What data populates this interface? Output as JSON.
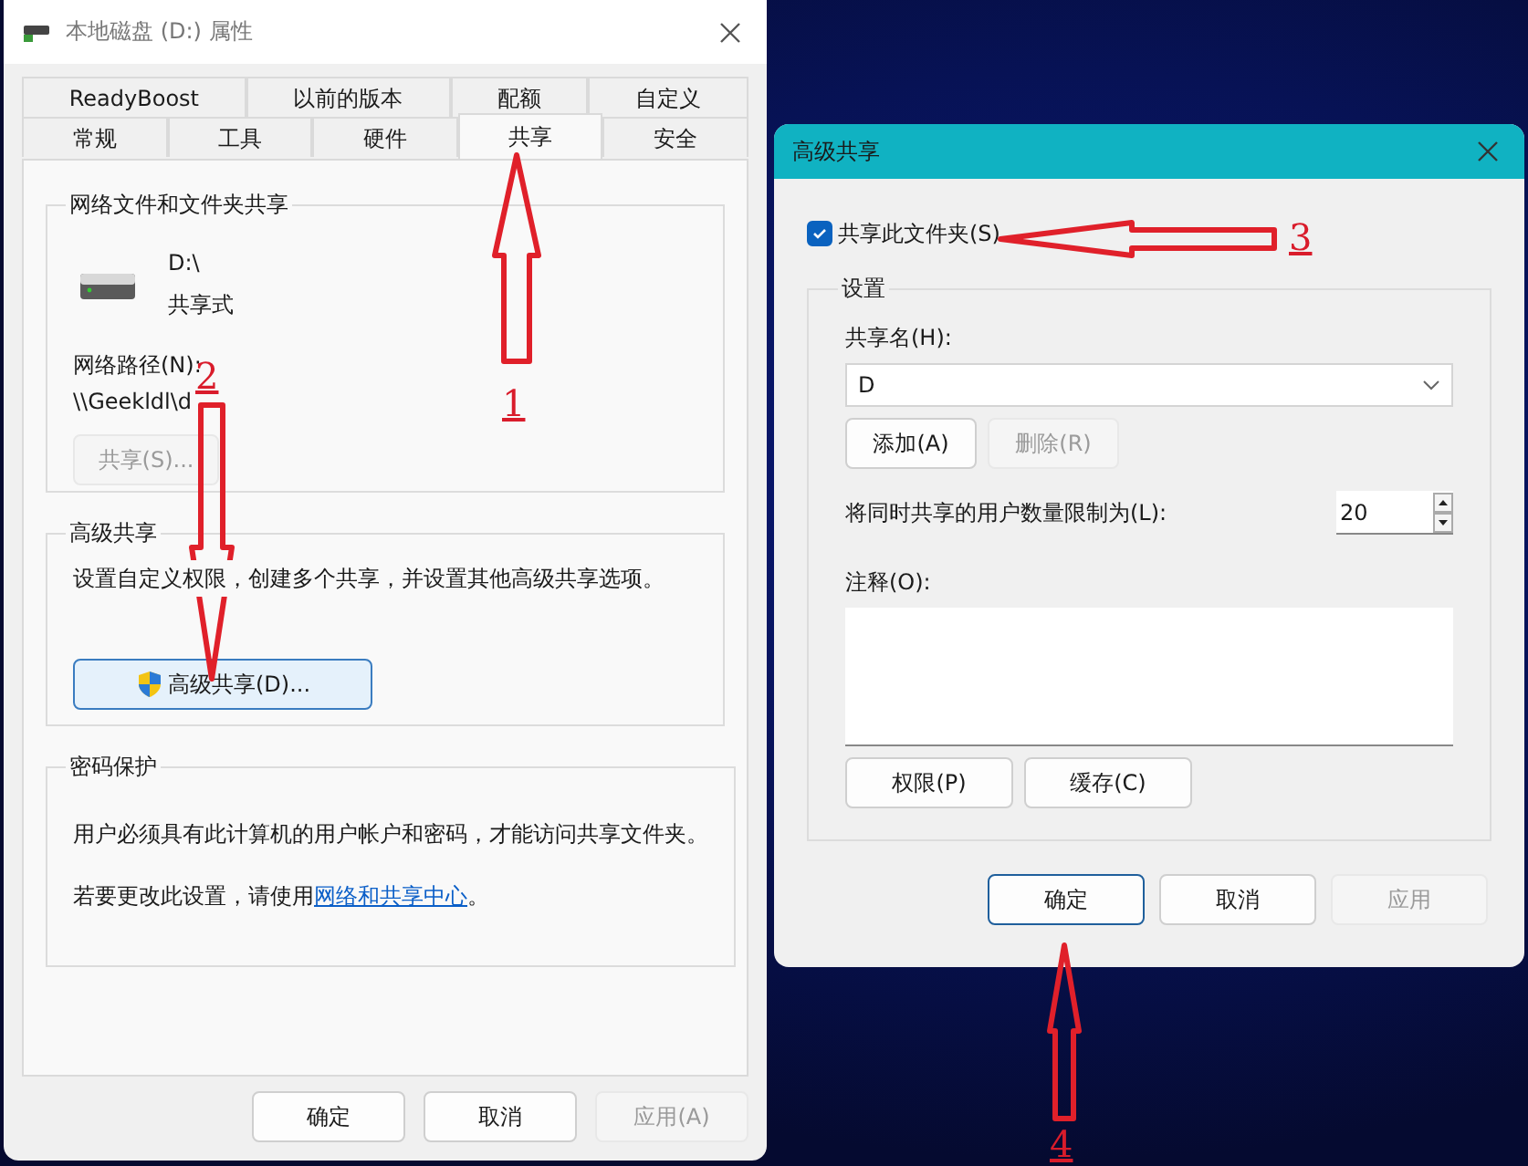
{
  "properties_window": {
    "title": "本地磁盘 (D:) 属性",
    "tabs_row_1": [
      {
        "label": "ReadyBoost",
        "selected": false
      },
      {
        "label": "以前的版本",
        "selected": false
      },
      {
        "label": "配额",
        "selected": false
      },
      {
        "label": "自定义",
        "selected": false
      }
    ],
    "tabs_row_2": [
      {
        "label": "常规",
        "selected": false
      },
      {
        "label": "工具",
        "selected": false
      },
      {
        "label": "硬件",
        "selected": false
      },
      {
        "label": "共享",
        "selected": true
      },
      {
        "label": "安全",
        "selected": false
      }
    ],
    "network_sharing": {
      "title": "网络文件和文件夹共享",
      "drive": "D:\\",
      "status": "共享式",
      "path_label": "网络路径(N):",
      "path": "\\\\Geekldl\\d",
      "share_button": {
        "label": "共享(S)...",
        "disabled": true
      }
    },
    "advanced_sharing": {
      "title": "高级共享",
      "description": "设置自定义权限，创建多个共享，并设置其他高级共享选项。",
      "button": {
        "label": "高级共享(D)...",
        "disabled": false
      }
    },
    "password_protection": {
      "title": "密码保护",
      "line_1": "用户必须具有此计算机的用户帐户和密码，才能访问共享文件夹。",
      "line_2_before": "若要更改此设置，请使用",
      "link": "网络和共享中心",
      "line_2_after": "。"
    },
    "buttons": [
      {
        "label": "确定",
        "disabled": false,
        "default": false
      },
      {
        "label": "取消",
        "disabled": false,
        "default": false
      },
      {
        "label": "应用(A)",
        "disabled": true,
        "default": false
      }
    ]
  },
  "advanced_sharing_window": {
    "title": "高级共享",
    "share_checkbox": {
      "label": "共享此文件夹(S)",
      "checked": true
    },
    "settings": {
      "title": "设置",
      "share_name_label": "共享名(H):",
      "share_name": "D",
      "name_buttons": [
        {
          "label": "添加(A)",
          "disabled": false
        },
        {
          "label": "删除(R)",
          "disabled": true
        }
      ],
      "limit_label": "将同时共享的用户数量限制为(L):",
      "limit_value": "20",
      "comment_label": "注释(O):",
      "buttons": [
        {
          "label": "权限(P)",
          "disabled": false
        },
        {
          "label": "缓存(C)",
          "disabled": false
        }
      ]
    },
    "buttons": [
      {
        "label": "确定",
        "disabled": false,
        "default": true
      },
      {
        "label": "取消",
        "disabled": false,
        "default": false
      },
      {
        "label": "应用",
        "disabled": true,
        "default": false
      }
    ]
  },
  "annotations": [
    {
      "label": "1"
    },
    {
      "label": "2"
    },
    {
      "label": "3"
    },
    {
      "label": "4"
    }
  ]
}
